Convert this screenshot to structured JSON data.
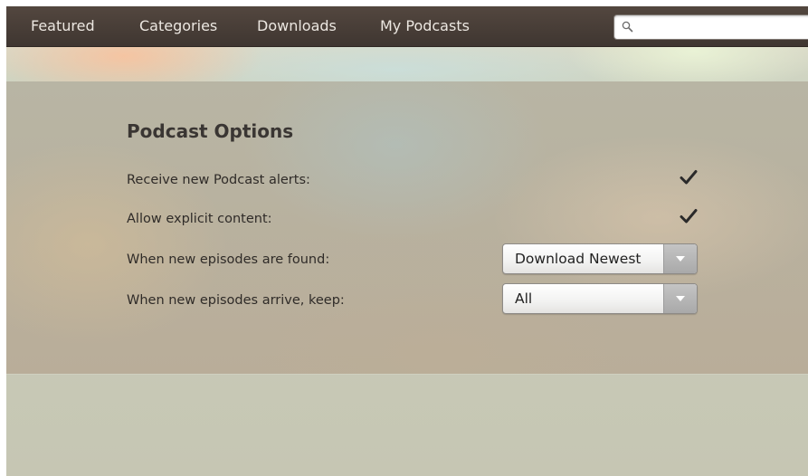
{
  "nav": {
    "items": [
      {
        "label": "Featured"
      },
      {
        "label": "Categories"
      },
      {
        "label": "Downloads"
      },
      {
        "label": "My Podcasts"
      }
    ],
    "search": {
      "value": "",
      "placeholder": "",
      "icon": "search-icon"
    }
  },
  "panel": {
    "title": "Podcast Options",
    "options": [
      {
        "label": "Receive new Podcast alerts:",
        "checked": true
      },
      {
        "label": "Allow explicit content:",
        "checked": true
      },
      {
        "label": "When new episodes are found:",
        "value": "Download Newest"
      },
      {
        "label": "When new episodes arrive, keep:",
        "value": "All"
      }
    ]
  },
  "colors": {
    "nav_bg": "#4a403a",
    "nav_text": "#ece7e1",
    "title_text": "#3a3633",
    "label_text": "#2f2b28",
    "check_mark": "#2a2a2a"
  }
}
